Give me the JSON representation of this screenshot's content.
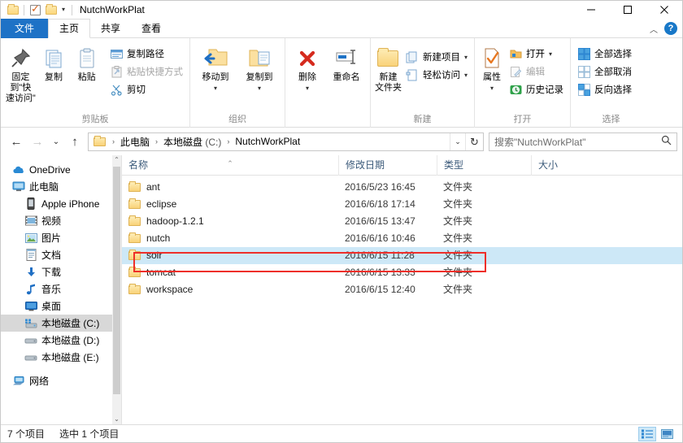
{
  "window": {
    "title": "NutchWorkPlat",
    "quick_access": {
      "folder_icon": "folder-icon",
      "properties_icon": "checkbox-properties-icon",
      "new_folder_icon": "new-folder-icon",
      "customize_caret": "▾"
    },
    "controls": {
      "minimize": "minimize-icon",
      "maximize": "maximize-icon",
      "close": "close-icon"
    }
  },
  "tabs": {
    "file": "文件",
    "items": [
      {
        "label": "主页",
        "active": true
      },
      {
        "label": "共享",
        "active": false
      },
      {
        "label": "查看",
        "active": false
      }
    ],
    "collapse_ribbon": "︿",
    "help": "?"
  },
  "ribbon": {
    "groups": [
      {
        "title": "剪贴板",
        "big_buttons": [
          {
            "label": "固定到\"快\n速访问\"",
            "line1": "固定到\"快",
            "line2": "速访问\"",
            "icon": "pin-icon"
          },
          {
            "label": "复制",
            "icon": "copy-icon"
          },
          {
            "label": "粘贴",
            "icon": "paste-icon"
          }
        ],
        "small_buttons": [
          {
            "label": "复制路径",
            "icon": "copy-path-icon",
            "disabled": false
          },
          {
            "label": "粘贴快捷方式",
            "icon": "paste-shortcut-icon",
            "disabled": true
          },
          {
            "label": "剪切",
            "icon": "scissors-icon",
            "disabled": false
          }
        ]
      },
      {
        "title": "组织",
        "big_buttons": [
          {
            "label": "移动到",
            "icon": "move-to-icon",
            "caret": "▾"
          },
          {
            "label": "复制到",
            "icon": "copy-to-icon",
            "caret": "▾"
          },
          {
            "label": "删除",
            "icon": "delete-icon",
            "caret": "▾"
          },
          {
            "label": "重命名",
            "icon": "rename-icon"
          }
        ]
      },
      {
        "title": "新建",
        "big_buttons": [
          {
            "label": "新建\n文件夹",
            "line1": "新建",
            "line2": "文件夹",
            "icon": "new-folder-icon"
          }
        ],
        "small_buttons": [
          {
            "label": "新建项目",
            "icon": "new-item-icon",
            "caret": "▾"
          },
          {
            "label": "轻松访问",
            "icon": "easy-access-icon",
            "caret": "▾"
          }
        ]
      },
      {
        "title": "打开",
        "big_buttons": [
          {
            "label": "属性",
            "icon": "properties-icon",
            "caret": "▾"
          }
        ],
        "small_buttons": [
          {
            "label": "打开",
            "icon": "open-icon",
            "caret": "▾",
            "disabled": false
          },
          {
            "label": "编辑",
            "icon": "edit-icon",
            "disabled": true
          },
          {
            "label": "历史记录",
            "icon": "history-icon",
            "disabled": false
          }
        ]
      },
      {
        "title": "选择",
        "small_buttons": [
          {
            "label": "全部选择",
            "icon": "select-all-icon"
          },
          {
            "label": "全部取消",
            "icon": "select-none-icon"
          },
          {
            "label": "反向选择",
            "icon": "invert-selection-icon"
          }
        ]
      }
    ]
  },
  "address_bar": {
    "back": "←",
    "forward": "→",
    "recent": "⌄",
    "up": "↑",
    "breadcrumbs": [
      {
        "label": "此电脑",
        "dim_suffix": ""
      },
      {
        "label": "本地磁盘",
        "dim_suffix": " (C:)"
      },
      {
        "label": "NutchWorkPlat",
        "dim_suffix": ""
      }
    ],
    "separator": "›",
    "dropdown_caret": "⌄",
    "refresh": "↻",
    "search_placeholder": "搜索\"NutchWorkPlat\"",
    "search_value": "",
    "search_icon": "search-icon"
  },
  "nav_pane": {
    "items": [
      {
        "label": "OneDrive",
        "icon": "onedrive-cloud-icon",
        "indent": 0,
        "selected": false
      },
      {
        "label": "此电脑",
        "icon": "this-pc-monitor-icon",
        "indent": 0,
        "selected": false
      },
      {
        "label": "Apple iPhone",
        "icon": "phone-icon",
        "indent": 1,
        "selected": false
      },
      {
        "label": "视频",
        "icon": "videos-icon",
        "indent": 1,
        "selected": false
      },
      {
        "label": "图片",
        "icon": "pictures-icon",
        "indent": 1,
        "selected": false
      },
      {
        "label": "文档",
        "icon": "documents-icon",
        "indent": 1,
        "selected": false
      },
      {
        "label": "下载",
        "icon": "downloads-arrow-icon",
        "indent": 1,
        "selected": false
      },
      {
        "label": "音乐",
        "icon": "music-note-icon",
        "indent": 1,
        "selected": false
      },
      {
        "label": "桌面",
        "icon": "desktop-icon",
        "indent": 1,
        "selected": false
      },
      {
        "label": "本地磁盘 (C:)",
        "icon": "system-drive-icon",
        "indent": 1,
        "selected": true
      },
      {
        "label": "本地磁盘 (D:)",
        "icon": "drive-icon",
        "indent": 1,
        "selected": false
      },
      {
        "label": "本地磁盘 (E:)",
        "icon": "drive-icon",
        "indent": 1,
        "selected": false
      },
      {
        "label": "网络",
        "icon": "network-icon",
        "indent": 0,
        "selected": false
      }
    ],
    "scroll_up": "⌃",
    "scroll_down": "⌄"
  },
  "file_list": {
    "columns": [
      {
        "label": "名称",
        "sorted": true,
        "sort_arrow": "⌃"
      },
      {
        "label": "修改日期",
        "sorted": false
      },
      {
        "label": "类型",
        "sorted": false
      },
      {
        "label": "大小",
        "sorted": false
      }
    ],
    "rows": [
      {
        "name": "ant",
        "date": "2016/5/23 16:45",
        "type": "文件夹",
        "size": "",
        "icon": "folder-icon",
        "selected": false
      },
      {
        "name": "eclipse",
        "date": "2016/6/18 17:14",
        "type": "文件夹",
        "size": "",
        "icon": "folder-icon",
        "selected": false
      },
      {
        "name": "hadoop-1.2.1",
        "date": "2016/6/15 13:47",
        "type": "文件夹",
        "size": "",
        "icon": "folder-icon",
        "selected": false
      },
      {
        "name": "nutch",
        "date": "2016/6/16 10:46",
        "type": "文件夹",
        "size": "",
        "icon": "folder-icon",
        "selected": false
      },
      {
        "name": "solr",
        "date": "2016/6/15 11:28",
        "type": "文件夹",
        "size": "",
        "icon": "folder-icon",
        "selected": true
      },
      {
        "name": "tomcat",
        "date": "2016/6/15 13:33",
        "type": "文件夹",
        "size": "",
        "icon": "folder-icon",
        "selected": false
      },
      {
        "name": "workspace",
        "date": "2016/6/15 12:40",
        "type": "文件夹",
        "size": "",
        "icon": "folder-icon",
        "selected": false
      }
    ],
    "highlight_color": "#ee2f2a",
    "selection_color": "#cde8f7"
  },
  "status_bar": {
    "item_count": "7 个项目",
    "selection_info": "选中 1 个项目",
    "details_view_icon": "details-view-icon",
    "large_icons_view_icon": "large-icons-view-icon"
  }
}
